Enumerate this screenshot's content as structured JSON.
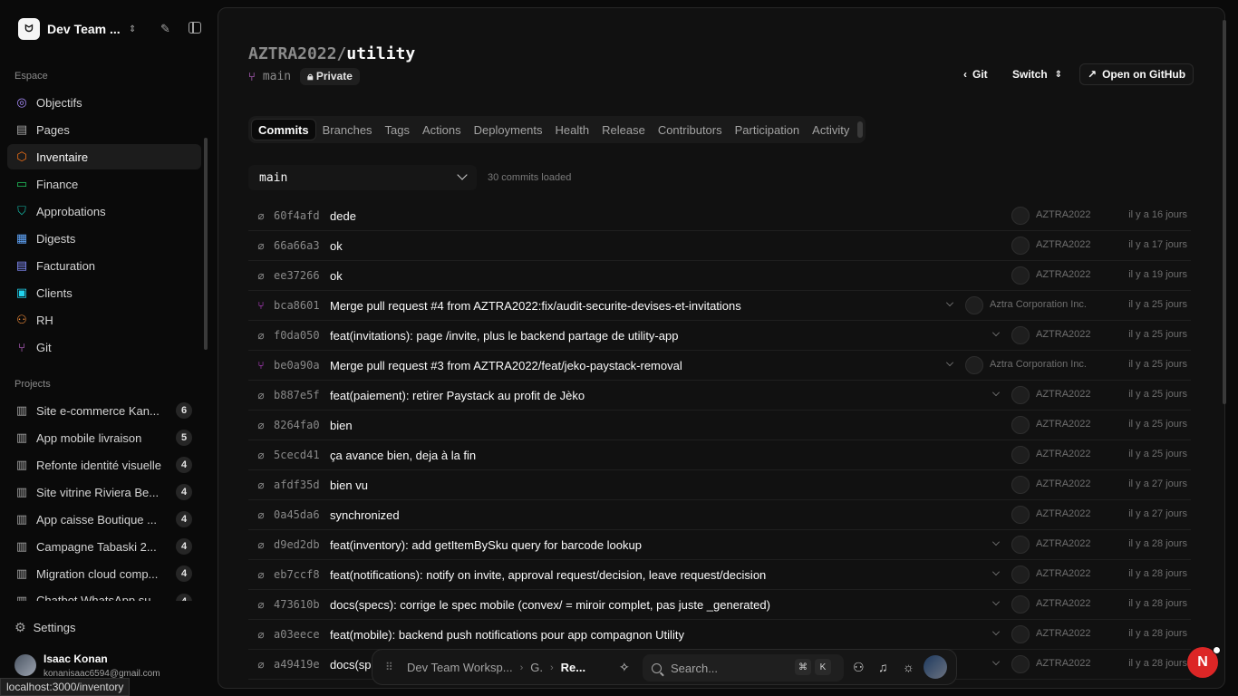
{
  "workspace": {
    "name": "Dev Team ...",
    "logo_text": "ᗢ"
  },
  "sidebar": {
    "space_label": "Espace",
    "items": [
      {
        "label": "Objectifs",
        "icon": "target-icon",
        "color": "#a78bfa",
        "glyph": "◎"
      },
      {
        "label": "Pages",
        "icon": "file-icon",
        "color": "#a3a3a3",
        "glyph": "▤"
      },
      {
        "label": "Inventaire",
        "icon": "package-icon",
        "color": "#f97316",
        "glyph": "⬡"
      },
      {
        "label": "Finance",
        "icon": "wallet-icon",
        "color": "#22c55e",
        "glyph": "▭"
      },
      {
        "label": "Approbations",
        "icon": "shield-check-icon",
        "color": "#14b8a6",
        "glyph": "⛉"
      },
      {
        "label": "Digests",
        "icon": "newspaper-icon",
        "color": "#60a5fa",
        "glyph": "▦"
      },
      {
        "label": "Facturation",
        "icon": "receipt-icon",
        "color": "#818cf8",
        "glyph": "▤"
      },
      {
        "label": "Clients",
        "icon": "contact-icon",
        "color": "#22d3ee",
        "glyph": "▣"
      },
      {
        "label": "RH",
        "icon": "users-icon",
        "color": "#fb923c",
        "glyph": "⚇"
      },
      {
        "label": "Git",
        "icon": "git-branch-icon",
        "color": "#e879f9",
        "glyph": "⑂"
      }
    ],
    "projects_label": "Projects",
    "projects": [
      {
        "name": "Site e-commerce Kan...",
        "count": "6"
      },
      {
        "name": "App mobile livraison",
        "count": "5"
      },
      {
        "name": "Refonte identité visuelle",
        "count": "4"
      },
      {
        "name": "Site vitrine Riviera Be...",
        "count": "4"
      },
      {
        "name": "App caisse Boutique ...",
        "count": "4"
      },
      {
        "name": "Campagne Tabaski 2...",
        "count": "4"
      },
      {
        "name": "Migration cloud comp...",
        "count": "4"
      },
      {
        "name": "Chatbot WhatsApp su...",
        "count": "4"
      }
    ],
    "settings_label": "Settings",
    "user": {
      "name": "Isaac Konan",
      "email": "konanisaac6594@gmail.com"
    }
  },
  "status_url": "localhost:3000/inventory",
  "repo": {
    "owner": "AZTRA2022/",
    "name": "utility",
    "branch": "main",
    "visibility": "Private"
  },
  "header_actions": {
    "git": "Git",
    "switch": "Switch",
    "open": "Open on GitHub"
  },
  "tabs": [
    "Commits",
    "Branches",
    "Tags",
    "Actions",
    "Deployments",
    "Health",
    "Release",
    "Contributors",
    "Participation",
    "Activity"
  ],
  "active_tab": "Commits",
  "branch_select": {
    "value": "main"
  },
  "commit_count": "30 commits loaded",
  "commits": [
    {
      "sha": "60f4afd",
      "msg": "dede",
      "author": "AZTRA2022",
      "time": "il y a 16 jours",
      "merge": false,
      "expand": false
    },
    {
      "sha": "66a66a3",
      "msg": "ok",
      "author": "AZTRA2022",
      "time": "il y a 17 jours",
      "merge": false,
      "expand": false
    },
    {
      "sha": "ee37266",
      "msg": "ok",
      "author": "AZTRA2022",
      "time": "il y a 19 jours",
      "merge": false,
      "expand": false
    },
    {
      "sha": "bca8601",
      "msg": "Merge pull request #4 from AZTRA2022:fix/audit-securite-devises-et-invitations",
      "author": "Aztra Corporation Inc.",
      "time": "il y a 25 jours",
      "merge": true,
      "expand": true
    },
    {
      "sha": "f0da050",
      "msg": "feat(invitations): page /invite, plus le backend partage de utility-app",
      "author": "AZTRA2022",
      "time": "il y a 25 jours",
      "merge": false,
      "expand": true
    },
    {
      "sha": "be0a90a",
      "msg": "Merge pull request #3 from AZTRA2022/feat/jeko-paystack-removal",
      "author": "Aztra Corporation Inc.",
      "time": "il y a 25 jours",
      "merge": true,
      "expand": true
    },
    {
      "sha": "b887e5f",
      "msg": "feat(paiement): retirer Paystack au profit de Jèko",
      "author": "AZTRA2022",
      "time": "il y a 25 jours",
      "merge": false,
      "expand": true
    },
    {
      "sha": "8264fa0",
      "msg": "bien",
      "author": "AZTRA2022",
      "time": "il y a 25 jours",
      "merge": false,
      "expand": false
    },
    {
      "sha": "5cecd41",
      "msg": "ça avance bien, deja à la fin",
      "author": "AZTRA2022",
      "time": "il y a 25 jours",
      "merge": false,
      "expand": false
    },
    {
      "sha": "afdf35d",
      "msg": "bien vu",
      "author": "AZTRA2022",
      "time": "il y a 27 jours",
      "merge": false,
      "expand": false
    },
    {
      "sha": "0a45da6",
      "msg": "synchronized",
      "author": "AZTRA2022",
      "time": "il y a 27 jours",
      "merge": false,
      "expand": false
    },
    {
      "sha": "d9ed2db",
      "msg": "feat(inventory): add getItemBySku query for barcode lookup",
      "author": "AZTRA2022",
      "time": "il y a 28 jours",
      "merge": false,
      "expand": true
    },
    {
      "sha": "eb7ccf8",
      "msg": "feat(notifications): notify on invite, approval request/decision, leave request/decision",
      "author": "AZTRA2022",
      "time": "il y a 28 jours",
      "merge": false,
      "expand": true
    },
    {
      "sha": "473610b",
      "msg": "docs(specs): corrige le spec mobile (convex/ = miroir complet, pas juste _generated)",
      "author": "AZTRA2022",
      "time": "il y a 28 jours",
      "merge": false,
      "expand": true
    },
    {
      "sha": "a03eece",
      "msg": "feat(mobile): backend push notifications pour app compagnon Utility",
      "author": "AZTRA2022",
      "time": "il y a 28 jours",
      "merge": false,
      "expand": true
    },
    {
      "sha": "a49419e",
      "msg": "docs(sp",
      "author": "AZTRA2022",
      "time": "il y a 28 jours",
      "merge": false,
      "expand": true
    }
  ],
  "dock": {
    "crumbs": [
      "Dev Team Worksp...",
      "G.",
      "Re..."
    ],
    "search_placeholder": "Search...",
    "kbd1": "⌘",
    "kbd2": "K"
  },
  "fab": {
    "label": "N"
  }
}
